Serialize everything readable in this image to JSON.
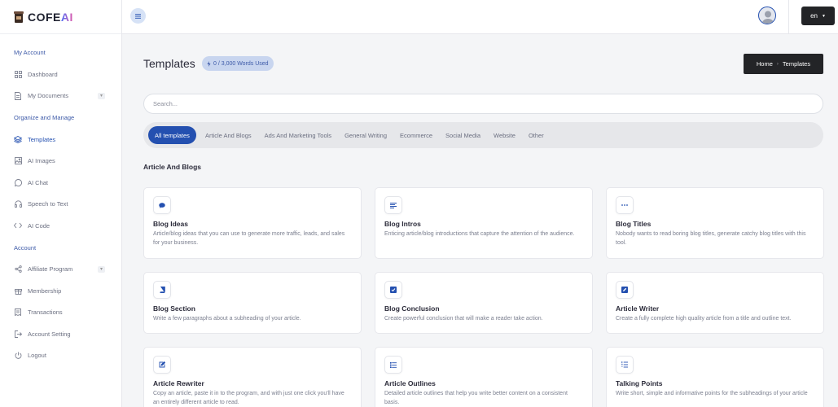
{
  "brand": {
    "name": "COFE",
    "name_accent": "AI"
  },
  "sidebar": {
    "sections": [
      {
        "label": "My Account",
        "items": [
          {
            "label": "Dashboard",
            "icon": "grid-icon"
          },
          {
            "label": "My Documents",
            "icon": "document-icon",
            "expandable": true
          }
        ]
      },
      {
        "label": "Organize and Manage",
        "items": [
          {
            "label": "Templates",
            "icon": "layers-icon",
            "active": true
          },
          {
            "label": "AI Images",
            "icon": "image-icon"
          },
          {
            "label": "AI Chat",
            "icon": "chat-icon"
          },
          {
            "label": "Speech to Text",
            "icon": "headphones-icon"
          },
          {
            "label": "AI Code",
            "icon": "code-icon"
          }
        ]
      },
      {
        "label": "Account",
        "items": [
          {
            "label": "Affiliate Program",
            "icon": "share-icon",
            "expandable": true
          },
          {
            "label": "Membership",
            "icon": "gift-icon"
          },
          {
            "label": "Transactions",
            "icon": "receipt-icon"
          },
          {
            "label": "Account Setting",
            "icon": "sign-in-icon"
          },
          {
            "label": "Logout",
            "icon": "power-icon"
          }
        ]
      }
    ]
  },
  "topbar": {
    "lang": "en"
  },
  "page": {
    "title": "Templates",
    "words_used": "0 / 3,000 Words Used",
    "breadcrumb": {
      "home": "Home",
      "current": "Templates"
    },
    "search_placeholder": "Search...",
    "tabs": [
      "All templates",
      "Article And Blogs",
      "Ads And Marketing Tools",
      "General Writing",
      "Ecommerce",
      "Social Media",
      "Website",
      "Other"
    ],
    "section_heading": "Article And Blogs"
  },
  "cards": [
    {
      "title": "Blog Ideas",
      "desc": "Article/blog ideas that you can use to generate more traffic, leads, and sales for your business.",
      "icon": "chat-bubble-icon"
    },
    {
      "title": "Blog Intros",
      "desc": "Enticing article/blog introductions that capture the attention of the audience.",
      "icon": "align-left-icon"
    },
    {
      "title": "Blog Titles",
      "desc": "Nobody wants to read boring blog titles, generate catchy blog titles with this tool.",
      "icon": "ellipsis-icon"
    },
    {
      "title": "Blog Section",
      "desc": "Write a few paragraphs about a subheading of your article.",
      "icon": "book-icon"
    },
    {
      "title": "Blog Conclusion",
      "desc": "Create powerful conclusion that will make a reader take action.",
      "icon": "check-square-icon"
    },
    {
      "title": "Article Writer",
      "desc": "Create a fully complete high quality article from a title and outline text.",
      "icon": "pen-square-icon"
    },
    {
      "title": "Article Rewriter",
      "desc": "Copy an article, paste it in to the program, and with just one click you'll have an entirely different article to read.",
      "icon": "edit-icon"
    },
    {
      "title": "Article Outlines",
      "desc": "Detailed article outlines that help you write better content on a consistent basis.",
      "icon": "list-icon"
    },
    {
      "title": "Talking Points",
      "desc": "Write short, simple and informative points for the subheadings of your article",
      "icon": "list-ol-icon"
    }
  ],
  "colors": {
    "accent": "#2450b0",
    "dark": "#232427",
    "badge_bg": "#c8d5ef"
  }
}
